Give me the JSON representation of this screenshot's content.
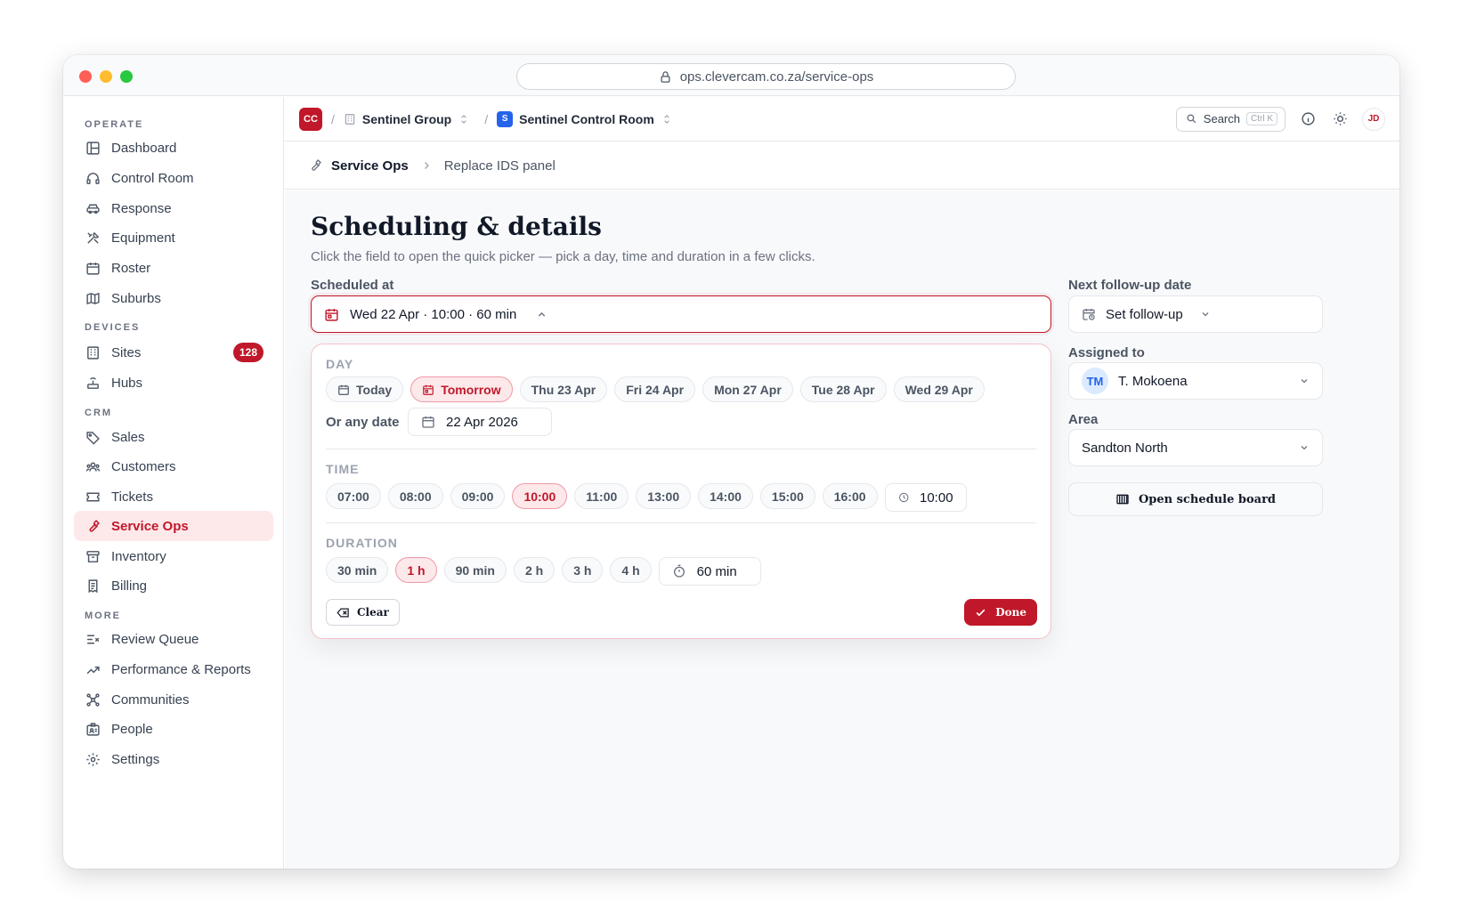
{
  "browser": {
    "url": "ops.clevercam.co.za/service-ops"
  },
  "sidebar": {
    "sections": [
      {
        "label": "OPERATE",
        "items": [
          {
            "label": "Dashboard",
            "icon": "layout-icon"
          },
          {
            "label": "Control Room",
            "icon": "headset-icon"
          },
          {
            "label": "Response",
            "icon": "car-icon"
          },
          {
            "label": "Equipment",
            "icon": "tools-icon"
          },
          {
            "label": "Roster",
            "icon": "calendar-icon"
          },
          {
            "label": "Suburbs",
            "icon": "map-icon"
          }
        ]
      },
      {
        "label": "DEVICES",
        "items": [
          {
            "label": "Sites",
            "icon": "building-icon",
            "badge": "128"
          },
          {
            "label": "Hubs",
            "icon": "hub-icon"
          }
        ]
      },
      {
        "label": "CRM",
        "items": [
          {
            "label": "Sales",
            "icon": "tag-icon"
          },
          {
            "label": "Customers",
            "icon": "users-icon"
          },
          {
            "label": "Tickets",
            "icon": "ticket-icon"
          },
          {
            "label": "Service Ops",
            "icon": "wrench-icon",
            "active": true
          },
          {
            "label": "Inventory",
            "icon": "archive-icon"
          },
          {
            "label": "Billing",
            "icon": "receipt-icon"
          }
        ]
      },
      {
        "label": "MORE",
        "items": [
          {
            "label": "Review Queue",
            "icon": "list-check-icon"
          },
          {
            "label": "Performance & Reports",
            "icon": "trend-icon"
          },
          {
            "label": "Communities",
            "icon": "network-icon"
          },
          {
            "label": "People",
            "icon": "id-card-icon"
          },
          {
            "label": "Settings",
            "icon": "gear-icon"
          }
        ]
      }
    ]
  },
  "topbar": {
    "logo": "CC",
    "org": "Sentinel Group",
    "workspace_logo": "S",
    "workspace": "Sentinel Control Room",
    "search_label": "Search",
    "search_shortcut": "Ctrl K",
    "user_initials": "JD"
  },
  "breadcrumb": {
    "section": "Service Ops",
    "page": "Replace IDS panel"
  },
  "page": {
    "title": "Scheduling & details",
    "subtitle": "Click the field to open the quick picker — pick a day, time and duration in a few clicks."
  },
  "scheduled": {
    "label": "Scheduled at",
    "value": "Wed 22 Apr · 10:00 · 60 min"
  },
  "picker": {
    "day_label": "DAY",
    "days": [
      {
        "label": "Today",
        "icon": "calendar-icon"
      },
      {
        "label": "Tomorrow",
        "icon": "calendar-icon",
        "selected": true
      },
      {
        "label": "Thu 23 Apr"
      },
      {
        "label": "Fri 24 Apr"
      },
      {
        "label": "Mon 27 Apr"
      },
      {
        "label": "Tue 28 Apr"
      },
      {
        "label": "Wed 29 Apr"
      }
    ],
    "any_date_label": "Or any date",
    "any_date_value": "22 Apr 2026",
    "time_label": "TIME",
    "times": [
      {
        "label": "07:00"
      },
      {
        "label": "08:00"
      },
      {
        "label": "09:00"
      },
      {
        "label": "10:00",
        "selected": true
      },
      {
        "label": "11:00"
      },
      {
        "label": "13:00"
      },
      {
        "label": "14:00"
      },
      {
        "label": "15:00"
      },
      {
        "label": "16:00"
      }
    ],
    "custom_time": "10:00",
    "duration_label": "DURATION",
    "durations": [
      {
        "label": "30 min"
      },
      {
        "label": "1 h",
        "selected": true
      },
      {
        "label": "90 min"
      },
      {
        "label": "2 h"
      },
      {
        "label": "3 h"
      },
      {
        "label": "4 h"
      }
    ],
    "custom_duration": "60 min",
    "clear_label": "Clear",
    "done_label": "Done"
  },
  "side_fields": {
    "followup_label": "Next follow-up date",
    "followup_value": "Set follow-up",
    "assigned_label": "Assigned to",
    "assigned_initials": "TM",
    "assigned_value": "T. Mokoena",
    "area_label": "Area",
    "area_value": "Sandton North",
    "board_label": "Open schedule board"
  },
  "colors": {
    "accent": "#c0182a",
    "accent_soft": "#fde8ea",
    "workspace_blue": "#2563eb"
  }
}
